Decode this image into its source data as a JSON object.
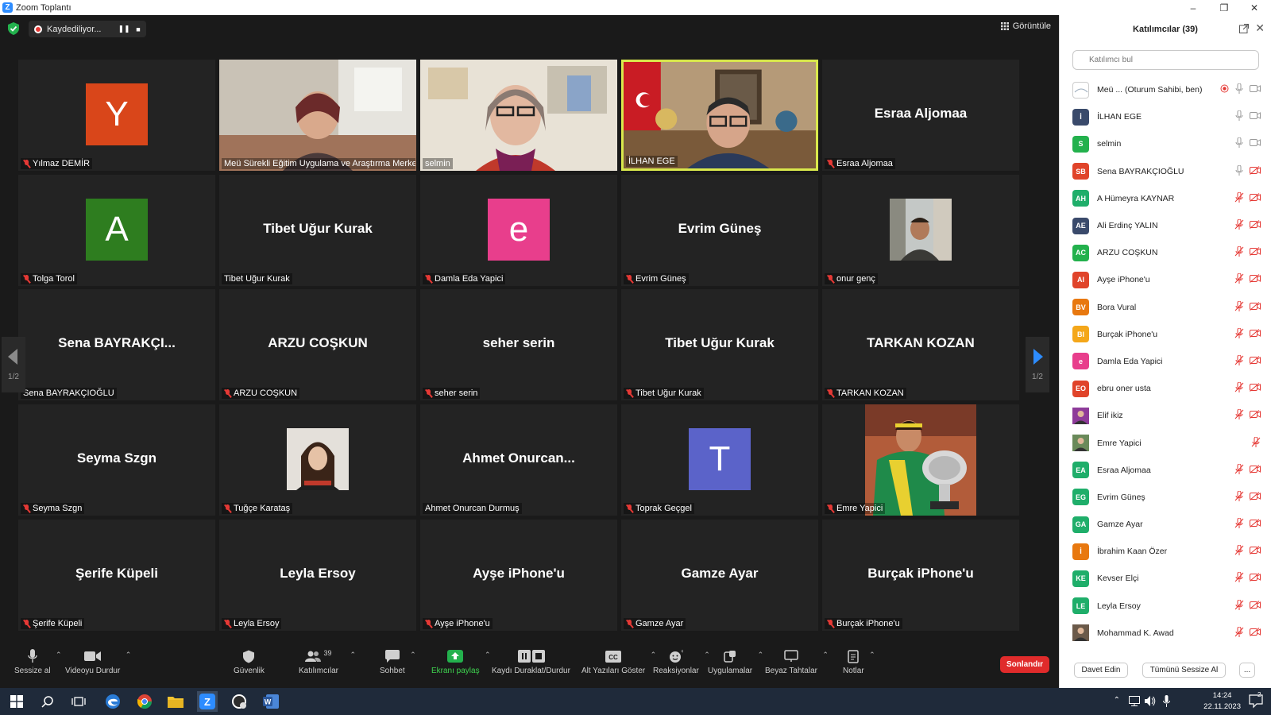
{
  "window": {
    "title": "Zoom Toplantı",
    "icon": "zoom-logo-icon"
  },
  "topbar": {
    "recording_label": "Kaydediliyor...",
    "view_label": "Görüntüle"
  },
  "grid": {
    "tiles": [
      {
        "name": "Yılmaz DEMİR",
        "avatar_letter": "Y",
        "avatar_color": "#d9461a",
        "muted": true,
        "type": "avatar"
      },
      {
        "name": "Meü Sürekli Eğitim Uygulama ve Araştırma Merkezi",
        "muted": false,
        "type": "video"
      },
      {
        "name": "selmin",
        "muted": false,
        "type": "video"
      },
      {
        "name": "İLHAN EGE",
        "muted": false,
        "type": "video",
        "active": true
      },
      {
        "name": "Esraa Aljomaa",
        "display_name": "Esraa Aljomaa",
        "muted": true,
        "type": "name"
      },
      {
        "name": "Tolga Torol",
        "avatar_letter": "A",
        "avatar_color": "#2e7d1f",
        "muted": true,
        "type": "avatar"
      },
      {
        "name": "Tibet Uğur Kurak",
        "display_name": "Tibet Uğur Kurak",
        "muted": false,
        "type": "name"
      },
      {
        "name": "Damla Eda Yapici",
        "avatar_letter": "e",
        "avatar_color": "#e83e8c",
        "muted": true,
        "type": "avatar"
      },
      {
        "name": "Evrim Güneş",
        "display_name": "Evrim Güneş",
        "muted": true,
        "type": "name"
      },
      {
        "name": "onur genç",
        "muted": true,
        "type": "photo"
      },
      {
        "name": "Sena BAYRAKÇIOĞLU",
        "display_name": "Sena  BAYRAKÇI...",
        "muted": false,
        "type": "name"
      },
      {
        "name": "ARZU COŞKUN",
        "display_name": "ARZU COŞKUN",
        "muted": true,
        "type": "name"
      },
      {
        "name": "seher serin",
        "display_name": "seher serin",
        "muted": true,
        "type": "name"
      },
      {
        "name": "Tibet Uğur Kurak",
        "display_name": "Tibet Uğur Kurak",
        "muted": true,
        "type": "name"
      },
      {
        "name": "TARKAN KOZAN",
        "display_name": "TARKAN KOZAN",
        "muted": true,
        "type": "name"
      },
      {
        "name": "Seyma Szgn",
        "display_name": "Seyma Szgn",
        "muted": true,
        "type": "name"
      },
      {
        "name": "Tuğçe Karataş",
        "muted": true,
        "type": "photo"
      },
      {
        "name": "Ahmet Onurcan Durmuş",
        "display_name": "Ahmet  Onurcan...",
        "muted": false,
        "type": "name"
      },
      {
        "name": "Toprak Geçgel",
        "avatar_letter": "T",
        "avatar_color": "#5b63c9",
        "muted": true,
        "type": "avatar"
      },
      {
        "name": "Emre Yapici",
        "muted": true,
        "type": "bigphoto"
      },
      {
        "name": "Şerife Küpeli",
        "display_name": "Şerife Küpeli",
        "muted": true,
        "type": "name"
      },
      {
        "name": "Leyla Ersoy",
        "display_name": "Leyla Ersoy",
        "muted": true,
        "type": "name"
      },
      {
        "name": "Ayşe iPhone'u",
        "display_name": "Ayşe iPhone'u",
        "muted": true,
        "type": "name"
      },
      {
        "name": "Gamze Ayar",
        "display_name": "Gamze Ayar",
        "muted": true,
        "type": "name"
      },
      {
        "name": "Burçak iPhone'u",
        "display_name": "Burçak iPhone'u",
        "muted": true,
        "type": "name"
      }
    ],
    "page_left": "1/2",
    "page_right": "1/2"
  },
  "toolbar": {
    "mute": "Sessize al",
    "video": "Videoyu Durdur",
    "security": "Güvenlik",
    "participants": "Katılımcılar",
    "participants_count": "39",
    "chat": "Sohbet",
    "share": "Ekranı paylaş",
    "record": "Kaydı Duraklat/Durdur",
    "captions": "Alt Yazıları Göster",
    "reactions": "Reaksiyonlar",
    "apps": "Uygulamalar",
    "whiteboard": "Beyaz Tahtalar",
    "notes": "Notlar",
    "end": "Sonlandır"
  },
  "panel": {
    "title": "Katılımcılar (39)",
    "search_placeholder": "Katılımcı bul",
    "participants": [
      {
        "name": "Meü ...  (Oturum Sahibi, ben)",
        "initials": "",
        "color": "#ffffff",
        "mic": "on",
        "cam": "on",
        "host": true
      },
      {
        "name": "İLHAN EGE",
        "initials": "İ",
        "color": "#3a4a6b",
        "mic": "on",
        "cam": "on"
      },
      {
        "name": "selmin",
        "initials": "S",
        "color": "#23b14d",
        "mic": "on",
        "cam": "on"
      },
      {
        "name": "Sena BAYRAKÇIOĞLU",
        "initials": "SB",
        "color": "#e0442a",
        "mic": "on",
        "cam": "off"
      },
      {
        "name": "A Hümeyra KAYNAR",
        "initials": "AH",
        "color": "#1fae6a",
        "mic": "off",
        "cam": "off"
      },
      {
        "name": "Ali Erdinç YALIN",
        "initials": "AE",
        "color": "#3a4a6b",
        "mic": "off",
        "cam": "off"
      },
      {
        "name": "ARZU COŞKUN",
        "initials": "AC",
        "color": "#23b14d",
        "mic": "off",
        "cam": "off"
      },
      {
        "name": "Ayşe iPhone'u",
        "initials": "AI",
        "color": "#e0442a",
        "mic": "off",
        "cam": "off"
      },
      {
        "name": "Bora Vural",
        "initials": "BV",
        "color": "#e8780f",
        "mic": "off",
        "cam": "off"
      },
      {
        "name": "Burçak iPhone'u",
        "initials": "BI",
        "color": "#f4a71a",
        "mic": "off",
        "cam": "off"
      },
      {
        "name": "Damla Eda Yapici",
        "initials": "e",
        "color": "#e83e8c",
        "mic": "off",
        "cam": "off"
      },
      {
        "name": "ebru oner usta",
        "initials": "EO",
        "color": "#e0442a",
        "mic": "off",
        "cam": "off"
      },
      {
        "name": "Elif ikiz",
        "initials": "",
        "color": "#8e3b9a",
        "mic": "off",
        "cam": "off",
        "photo": true
      },
      {
        "name": "Emre Yapici",
        "initials": "",
        "color": "#6a8a5a",
        "mic": "off",
        "cam": "none",
        "photo": true
      },
      {
        "name": "Esraa Aljomaa",
        "initials": "EA",
        "color": "#1fae6a",
        "mic": "off",
        "cam": "off"
      },
      {
        "name": "Evrim Güneş",
        "initials": "EG",
        "color": "#1fae6a",
        "mic": "off",
        "cam": "off"
      },
      {
        "name": "Gamze Ayar",
        "initials": "GA",
        "color": "#1fae6a",
        "mic": "off",
        "cam": "off"
      },
      {
        "name": "İbrahim Kaan Özer",
        "initials": "İ",
        "color": "#e8780f",
        "mic": "off",
        "cam": "off"
      },
      {
        "name": "Kevser Elçi",
        "initials": "KE",
        "color": "#1fae6a",
        "mic": "off",
        "cam": "off"
      },
      {
        "name": "Leyla Ersoy",
        "initials": "LE",
        "color": "#1fae6a",
        "mic": "off",
        "cam": "off"
      },
      {
        "name": "Mohammad K. Awad",
        "initials": "",
        "color": "#6b5a4a",
        "mic": "off",
        "cam": "off",
        "photo": true
      }
    ],
    "invite": "Davet Edin",
    "mute_all": "Tümünü Sessize Al",
    "more": "..."
  },
  "taskbar": {
    "time": "14:24",
    "date": "22.11.2023",
    "notification_count": "2"
  }
}
